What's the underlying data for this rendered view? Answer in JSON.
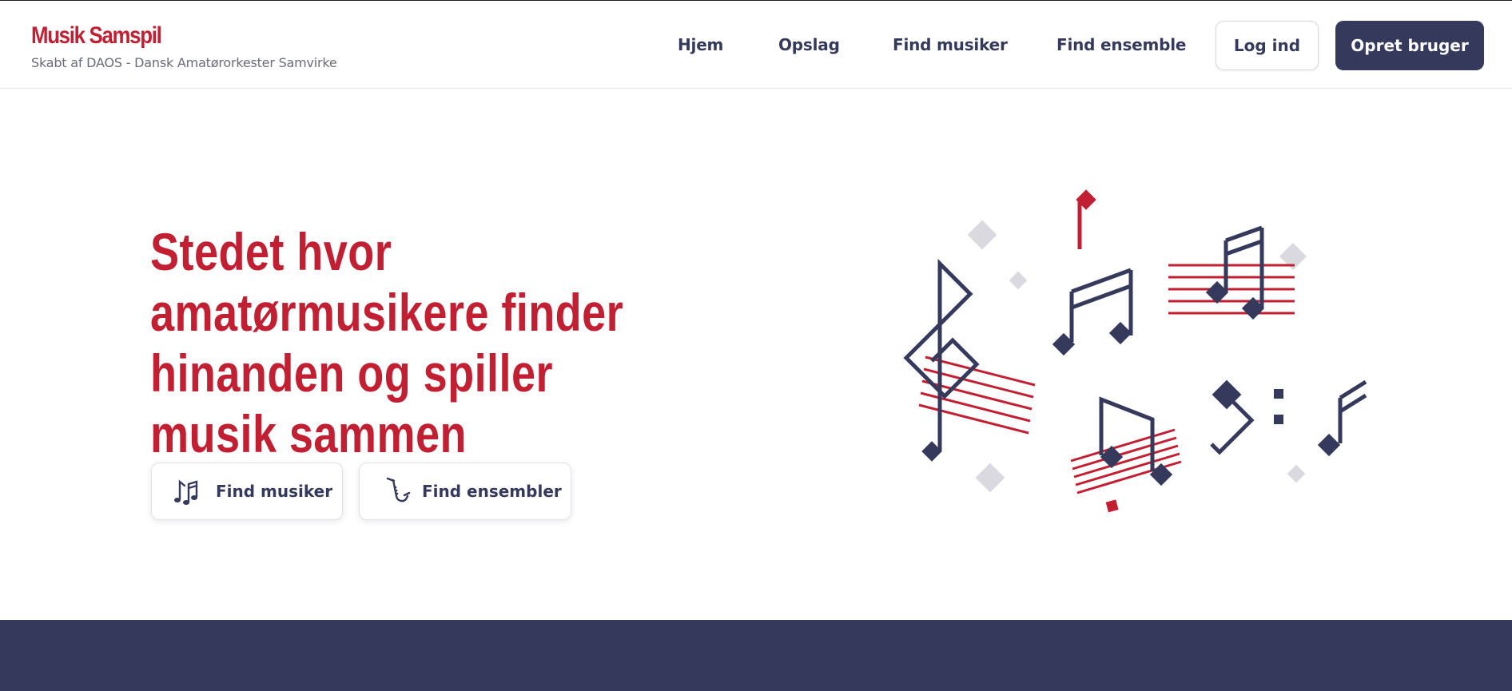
{
  "brand": {
    "title": "Musik Samspil",
    "subtitle": "Skabt af DAOS - Dansk Amatørorkester Samvirke"
  },
  "nav": {
    "items": [
      {
        "label": "Hjem"
      },
      {
        "label": "Opslag"
      },
      {
        "label": "Find musiker"
      },
      {
        "label": "Find ensemble"
      }
    ],
    "login_label": "Log ind",
    "signup_label": "Opret bruger"
  },
  "hero": {
    "title": "Stedet hvor amatørmusikere finder hinanden og spiller musik sammen",
    "buttons": [
      {
        "label": "Find musiker",
        "icon": "music-notes-icon"
      },
      {
        "label": "Find ensembler",
        "icon": "saxophone-icon"
      }
    ]
  },
  "colors": {
    "accent_red": "#c31f32",
    "navy": "#353a5c",
    "light_gray": "#d9d9df"
  }
}
